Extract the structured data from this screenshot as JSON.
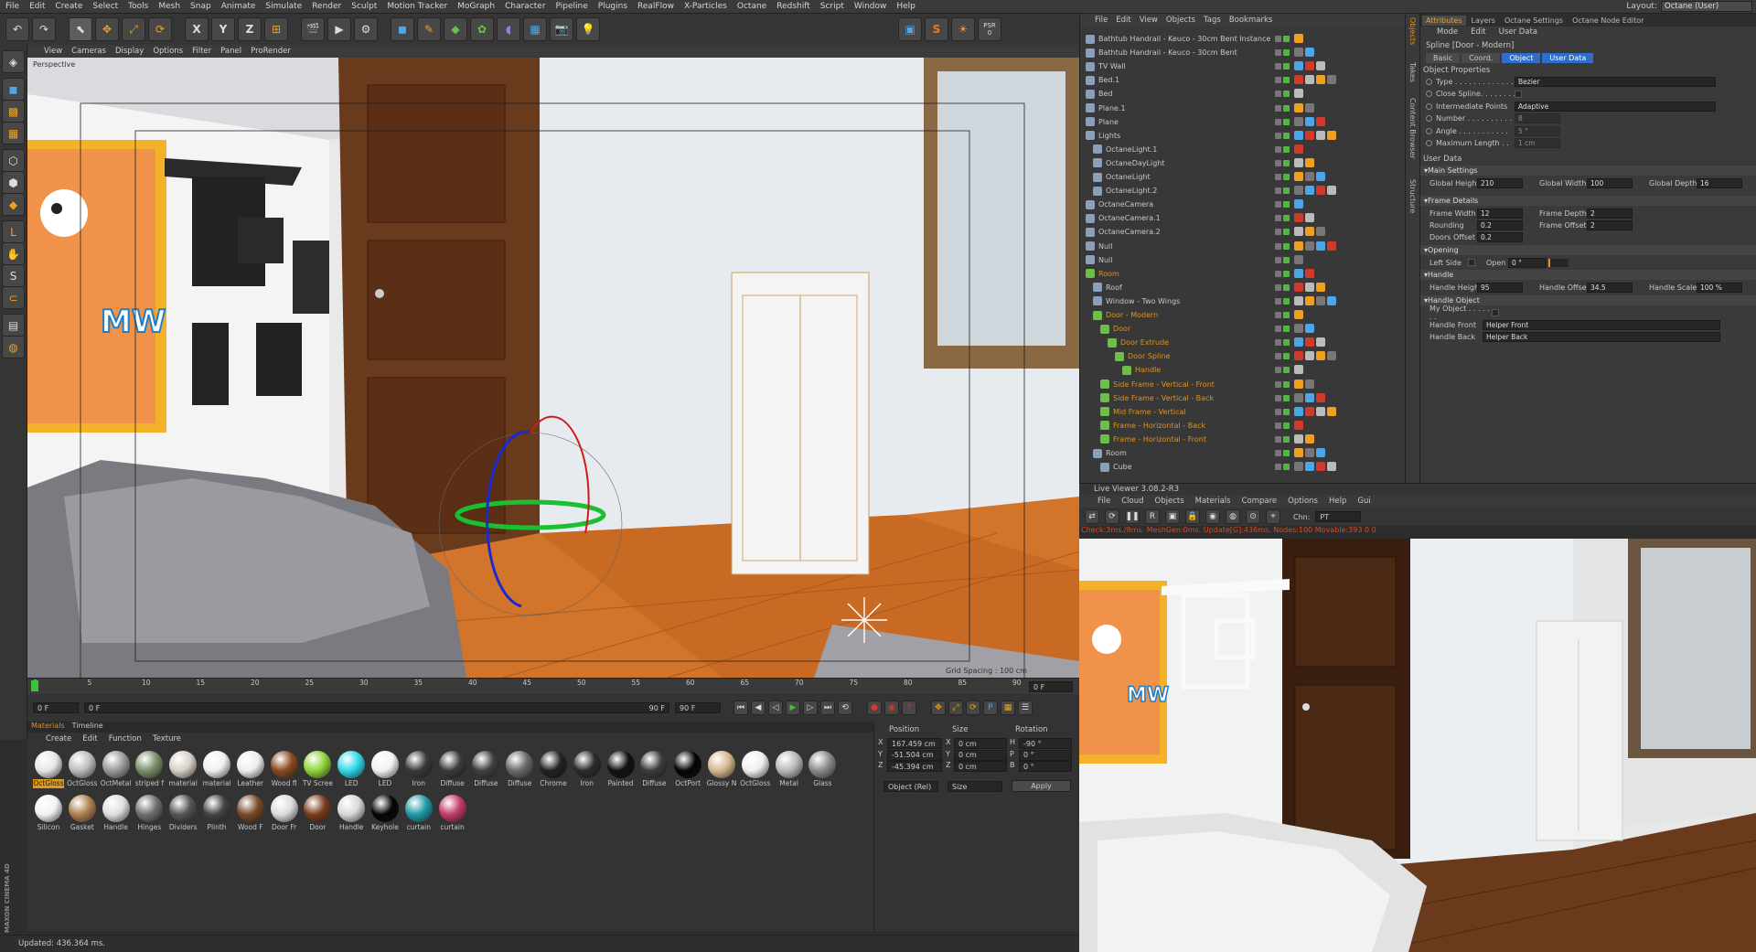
{
  "menu": [
    "File",
    "Edit",
    "Create",
    "Select",
    "Tools",
    "Mesh",
    "Snap",
    "Animate",
    "Simulate",
    "Render",
    "Sculpt",
    "Motion Tracker",
    "MoGraph",
    "Character",
    "Pipeline",
    "Plugins",
    "RealFlow",
    "X-Particles",
    "Octane",
    "Redshift",
    "Script",
    "Window",
    "Help"
  ],
  "layout": {
    "label": "Layout:",
    "value": "Octane (User)"
  },
  "toolbar": {
    "x": "X",
    "y": "Y",
    "z": "Z",
    "psr_label": "PSR",
    "psr_value": "0"
  },
  "viewport": {
    "menu": [
      "View",
      "Cameras",
      "Display",
      "Options",
      "Filter",
      "Panel",
      "ProRender"
    ],
    "label": "Perspective",
    "grid_spacing": "Grid Spacing : 100 cm",
    "poster_text": "MW"
  },
  "timeline": {
    "ticks": [
      "0",
      "5",
      "10",
      "15",
      "20",
      "25",
      "30",
      "35",
      "40",
      "45",
      "50",
      "55",
      "60",
      "65",
      "70",
      "75",
      "80",
      "85",
      "90"
    ],
    "end_frame": "0 F"
  },
  "playbar": {
    "start": "0 F",
    "current": "0 F",
    "end_field": "90 F",
    "end": "90 F"
  },
  "materials": {
    "tabs": [
      "Materials",
      "Timeline"
    ],
    "menu": [
      "Create",
      "Edit",
      "Function",
      "Texture"
    ],
    "row1": [
      {
        "label": "OctGloss",
        "color": "#e6e6e6",
        "selected": true
      },
      {
        "label": "OctGloss",
        "color": "#bdbdbd"
      },
      {
        "label": "OctMetal",
        "color": "#9a9a9a"
      },
      {
        "label": "striped f",
        "color": "#7a8f6a"
      },
      {
        "label": "material",
        "color": "#d8d0c8"
      },
      {
        "label": "material",
        "color": "#f0f0f0"
      },
      {
        "label": "Leather",
        "color": "#eeeeee"
      },
      {
        "label": "Wood fl",
        "color": "#8a4a20"
      },
      {
        "label": "TV Scree",
        "color": "#8fd43a"
      },
      {
        "label": "LED",
        "color": "#2fd8ea"
      },
      {
        "label": "LED",
        "color": "#f2f2f2"
      },
      {
        "label": "Iron",
        "color": "#3a3a3a"
      },
      {
        "label": "Diffuse",
        "color": "#3b3b3b"
      },
      {
        "label": "Diffuse",
        "color": "#404040"
      },
      {
        "label": "Diffuse",
        "color": "#6a6a6a"
      },
      {
        "label": "Chrome",
        "color": "#222222"
      },
      {
        "label": "Iron",
        "color": "#2c2c2c"
      },
      {
        "label": "Painted",
        "color": "#111111"
      },
      {
        "label": "Diffuse",
        "color": "#3c3c3c"
      },
      {
        "label": "OctPort",
        "color": "#050505"
      },
      {
        "label": "Glossy N",
        "color": "#d4b88c"
      },
      {
        "label": "OctGloss",
        "color": "#efefef"
      },
      {
        "label": "Metal",
        "color": "#b9b9b9"
      },
      {
        "label": "Glass",
        "color": "#8a8a8a"
      }
    ],
    "row2": [
      {
        "label": "Silicon",
        "color": "#f2f2f2"
      },
      {
        "label": "Gasket",
        "color": "#b08050"
      },
      {
        "label": "Handle",
        "color": "#dedede"
      },
      {
        "label": "Hinges",
        "color": "#6f6f6f"
      },
      {
        "label": "Dividers",
        "color": "#555555"
      },
      {
        "label": "Plinth",
        "color": "#444444"
      },
      {
        "label": "Wood F",
        "color": "#7a4a28"
      },
      {
        "label": "Door Fr",
        "color": "#dcdcdc"
      },
      {
        "label": "Door",
        "color": "#7a3c1e"
      },
      {
        "label": "Handle",
        "color": "#d8d8d8"
      },
      {
        "label": "Keyhole",
        "color": "#050505"
      },
      {
        "label": "curtain",
        "color": "#1f9aa8"
      },
      {
        "label": "curtain",
        "color": "#c43a6a"
      }
    ]
  },
  "coords": {
    "headers": [
      "Position",
      "Size",
      "Rotation"
    ],
    "rows": [
      {
        "axis": "X",
        "pos": "167.459 cm",
        "size_axis": "X",
        "size": "0 cm",
        "rot_axis": "H",
        "rot": "-90 °"
      },
      {
        "axis": "Y",
        "pos": "-51.504 cm",
        "size_axis": "Y",
        "size": "0 cm",
        "rot_axis": "P",
        "rot": "0 °"
      },
      {
        "axis": "Z",
        "pos": "-45.394 cm",
        "size_axis": "Z",
        "size": "0 cm",
        "rot_axis": "B",
        "rot": "0 °"
      }
    ],
    "mode": "Object (Rel)",
    "size_mode": "Size",
    "apply": "Apply"
  },
  "status": "Updated: 436.364 ms.",
  "maxon": "MAXON CINEMA 4D",
  "objects": {
    "menu": [
      "File",
      "Edit",
      "View",
      "Objects",
      "Tags",
      "Bookmarks"
    ],
    "rows": [
      {
        "name": "Bathtub Handrail - Keuco - 30cm Bent Instance",
        "indent": 0,
        "hl": false
      },
      {
        "name": "Bathtub Handrail - Keuco - 30cm Bent",
        "indent": 0,
        "hl": false
      },
      {
        "name": "TV Wall",
        "indent": 0,
        "hl": false
      },
      {
        "name": "Bed.1",
        "indent": 0,
        "hl": false
      },
      {
        "name": "Bed",
        "indent": 0,
        "hl": false
      },
      {
        "name": "Plane.1",
        "indent": 0,
        "hl": false
      },
      {
        "name": "Plane",
        "indent": 0,
        "hl": false
      },
      {
        "name": "Lights",
        "indent": 0,
        "hl": false
      },
      {
        "name": "OctaneLight.1",
        "indent": 1,
        "hl": false
      },
      {
        "name": "OctaneDayLight",
        "indent": 1,
        "hl": false
      },
      {
        "name": "OctaneLight",
        "indent": 1,
        "hl": false
      },
      {
        "name": "OctaneLight.2",
        "indent": 1,
        "hl": false
      },
      {
        "name": "OctaneCamera",
        "indent": 0,
        "hl": false
      },
      {
        "name": "OctaneCamera.1",
        "indent": 0,
        "hl": false
      },
      {
        "name": "OctaneCamera.2",
        "indent": 0,
        "hl": false
      },
      {
        "name": "Null",
        "indent": 0,
        "hl": false
      },
      {
        "name": "Null",
        "indent": 0,
        "hl": false
      },
      {
        "name": "Room",
        "indent": 0,
        "hl": true
      },
      {
        "name": "Roof",
        "indent": 1,
        "hl": false
      },
      {
        "name": "Window - Two Wings",
        "indent": 1,
        "hl": false
      },
      {
        "name": "Door - Modern",
        "indent": 1,
        "hl": true
      },
      {
        "name": "Door",
        "indent": 2,
        "hl": true
      },
      {
        "name": "Door Extrude",
        "indent": 3,
        "hl": true
      },
      {
        "name": "Door Spline",
        "indent": 4,
        "hl": true
      },
      {
        "name": "Handle",
        "indent": 5,
        "hl": true
      },
      {
        "name": "Side Frame - Vertical - Front",
        "indent": 2,
        "hl": true
      },
      {
        "name": "Side Frame - Vertical - Back",
        "indent": 2,
        "hl": true
      },
      {
        "name": "Mid Frame - Vertical",
        "indent": 2,
        "hl": true
      },
      {
        "name": "Frame - Horizontal - Back",
        "indent": 2,
        "hl": true
      },
      {
        "name": "Frame - Horizontal - Front",
        "indent": 2,
        "hl": true
      },
      {
        "name": "Room",
        "indent": 1,
        "hl": false
      },
      {
        "name": "Cube",
        "indent": 2,
        "hl": false
      }
    ]
  },
  "sidetabs": [
    "Objects",
    "Takes",
    "Content Browser",
    "Structure"
  ],
  "attributes": {
    "tabs": [
      "Attributes",
      "Layers",
      "Octane Settings",
      "Octane Node Editor"
    ],
    "menu": [
      "Mode",
      "Edit",
      "User Data"
    ],
    "object_title": "Spline [Door - Modern]",
    "subtabs": [
      "Basic",
      "Coord.",
      "Object",
      "User Data"
    ],
    "object_props": "Object Properties",
    "props": [
      {
        "label": "Type . . . . . . . . . . . . .",
        "value": "Bezier"
      },
      {
        "label": "Close Spline. . . . . . . .",
        "value": ""
      },
      {
        "label": "Intermediate Points",
        "value": "Adaptive"
      },
      {
        "label": "Number . . . . . . . . . .",
        "value": "8"
      },
      {
        "label": "Angle . . . . . . . . . . .",
        "value": "5 °"
      },
      {
        "label": "Maximum Length . .",
        "value": "1 cm"
      }
    ],
    "user_data": "User Data",
    "main_settings": "Main Settings",
    "main": [
      {
        "label": "Global Height",
        "value": "210"
      },
      {
        "label": "Global Width",
        "value": "100"
      },
      {
        "label": "Global Depth",
        "value": "16"
      }
    ],
    "frame_details": "Frame Details",
    "frame": [
      {
        "label": "Frame Width",
        "value": "12"
      },
      {
        "label": "Frame Depth",
        "value": "2"
      },
      {
        "label": "Rounding",
        "value": "0.2"
      },
      {
        "label": "Frame Offset",
        "value": "2"
      },
      {
        "label": "Doors Offset",
        "value": "0.2"
      }
    ],
    "opening": "Opening",
    "open_left": "Left Side",
    "open_label": "Open",
    "open_value": "0 °",
    "handle": "Handle",
    "handle_fields": [
      {
        "label": "Handle Height",
        "value": "95"
      },
      {
        "label": "Handle Offset",
        "value": "34.5"
      },
      {
        "label": "Handle Scale",
        "value": "100 %"
      }
    ],
    "handle_object": "Handle Object",
    "my_object": "My Object . . . . . . .",
    "handle_front_label": "Handle Front",
    "handle_front": "Helper Front",
    "handle_back_label": "Handle Back",
    "handle_back": "Helper Back"
  },
  "liveviewer": {
    "title": "Live Viewer 3.08.2-R3",
    "menu": [
      "File",
      "Cloud",
      "Objects",
      "Materials",
      "Compare",
      "Options",
      "Help",
      "Gui"
    ],
    "channel_label": "Chn:",
    "channel": "PT",
    "status": "Check:3ms./8ms. MeshGen:0ms. Update[G]:436ms. Nodes:100 Movable:393  0 0"
  },
  "colors": {
    "accent": "#e0931d",
    "green": "#4bbb3a",
    "red": "#cf3b2a"
  }
}
